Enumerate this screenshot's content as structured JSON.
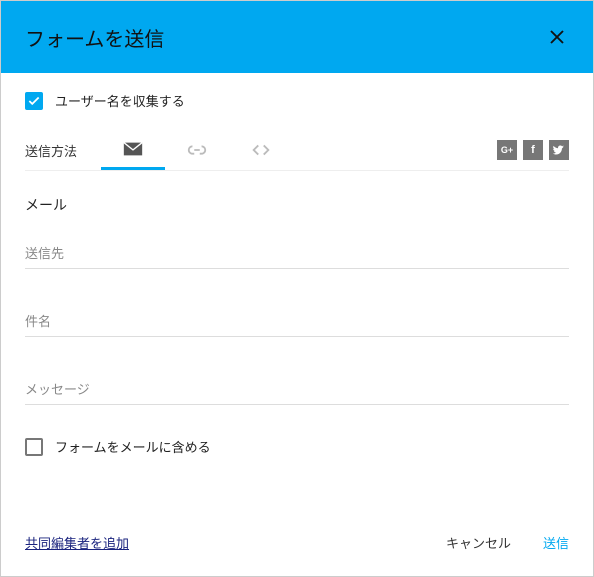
{
  "header": {
    "title": "フォームを送信"
  },
  "collect": {
    "label": "ユーザー名を収集する",
    "checked": true
  },
  "tabs": {
    "label": "送信方法"
  },
  "section": {
    "title": "メール"
  },
  "fields": {
    "to": {
      "label": "送信先"
    },
    "subject": {
      "label": "件名"
    },
    "message": {
      "label": "メッセージ"
    }
  },
  "include": {
    "label": "フォームをメールに含める",
    "checked": false
  },
  "footer": {
    "add_collaborator": "共同編集者を追加",
    "cancel": "キャンセル",
    "send": "送信"
  },
  "social": {
    "gplus": "G+",
    "fb": "f",
    "tw": "t"
  }
}
